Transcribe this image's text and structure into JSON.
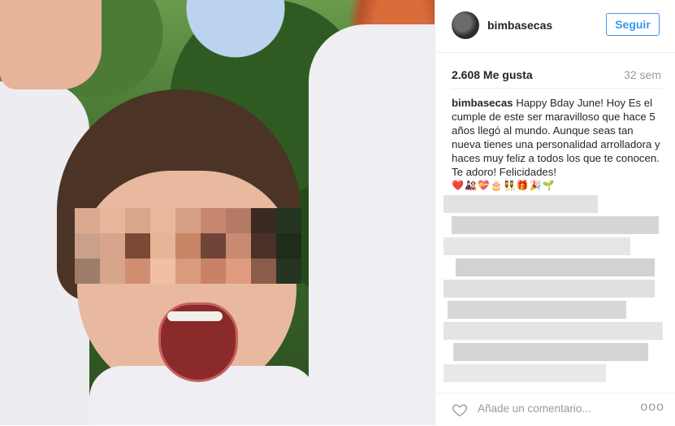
{
  "post": {
    "username": "bimbasecas",
    "follow_label": "Seguir",
    "likes": "2.608 Me gusta",
    "age": "32 sem",
    "caption_user": "bimbasecas",
    "caption_text": "Happy Bday June! Hoy Es el cumple de este ser maravilloso que hace 5 años llegó al mundo. Aunque seas tan nueva tienes una personalidad arrolladora y haces muy feliz a todos los que te conocen. Te adoro! Felicidades!",
    "caption_emojis": "❤️🎎💝🎂👯🎁🎉🌱",
    "comment_placeholder": "Añade un comentario...",
    "more_options": "ooo"
  },
  "icons": {
    "heart": "heart-icon",
    "more": "more-options-icon"
  },
  "colors": {
    "accent": "#3897f0",
    "text": "#262626",
    "muted": "#999999"
  }
}
